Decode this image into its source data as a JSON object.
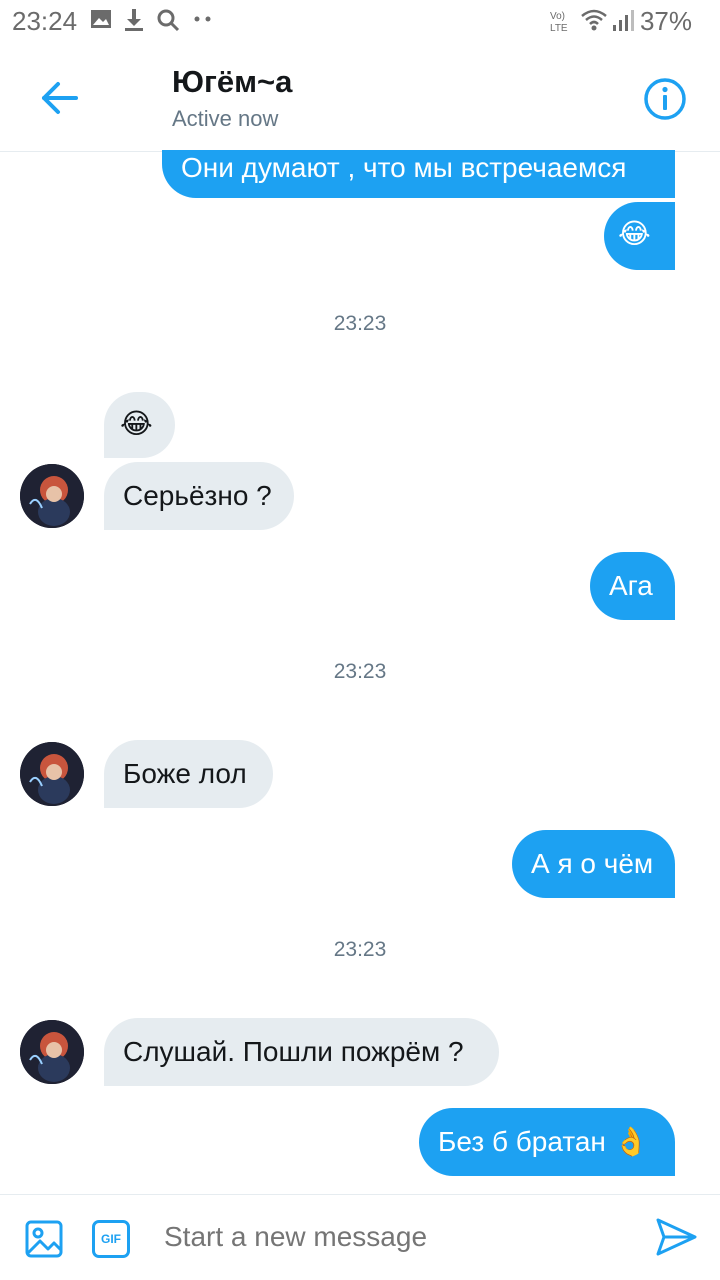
{
  "status_bar": {
    "time": "23:24",
    "network_label": "Vo) LTE",
    "battery": "37%",
    "icons": [
      "image-icon",
      "download-icon",
      "search-icon",
      "more-dots-icon",
      "wifi-icon",
      "signal-icon",
      "battery-icon"
    ]
  },
  "header": {
    "title": "Югём~а",
    "subtitle": "Active now"
  },
  "messages": [
    {
      "direction": "out",
      "text": "Они думают , что мы встречаемся"
    },
    {
      "direction": "out",
      "text": "😂"
    },
    {
      "timestamp": "23:23"
    },
    {
      "direction": "in",
      "text": "😂"
    },
    {
      "direction": "in",
      "text": "Серьёзно ?"
    },
    {
      "direction": "out",
      "text": "Ага"
    },
    {
      "timestamp": "23:23"
    },
    {
      "direction": "in",
      "text": "Боже лол"
    },
    {
      "direction": "out",
      "text": "А я о чём"
    },
    {
      "timestamp": "23:23"
    },
    {
      "direction": "in",
      "text": "Слушай. Пошли пожрём ?"
    },
    {
      "direction": "out",
      "text": "Без б братан 👌"
    }
  ],
  "composer": {
    "placeholder": "Start a new message",
    "gif_label": "GIF"
  },
  "colors": {
    "accent": "#1da1f2",
    "incoming_bubble": "#e6ecf0",
    "secondary_text": "#657786"
  }
}
